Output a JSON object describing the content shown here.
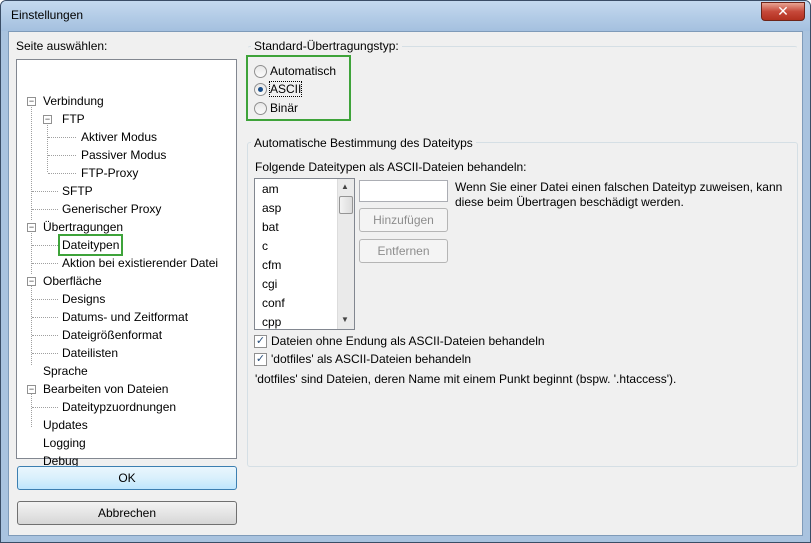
{
  "window": {
    "title": "Einstellungen",
    "close_glyph": "✕"
  },
  "tree": {
    "heading": "Seite auswählen:",
    "items": [
      {
        "label": "Verbindung"
      },
      {
        "label": "FTP"
      },
      {
        "label": "Aktiver Modus"
      },
      {
        "label": "Passiver Modus"
      },
      {
        "label": "FTP-Proxy"
      },
      {
        "label": "SFTP"
      },
      {
        "label": "Generischer Proxy"
      },
      {
        "label": "Übertragungen"
      },
      {
        "label": "Dateitypen",
        "selected": true
      },
      {
        "label": "Aktion bei existierender Datei"
      },
      {
        "label": "Oberfläche"
      },
      {
        "label": "Designs"
      },
      {
        "label": "Datums- und Zeitformat"
      },
      {
        "label": "Dateigrößenformat"
      },
      {
        "label": "Dateilisten"
      },
      {
        "label": "Sprache"
      },
      {
        "label": "Bearbeiten von Dateien"
      },
      {
        "label": "Dateitypzuordnungen"
      },
      {
        "label": "Updates"
      },
      {
        "label": "Logging"
      },
      {
        "label": "Debug"
      }
    ],
    "expander_glyph": "−"
  },
  "buttons": {
    "ok": "OK",
    "cancel": "Abbrechen"
  },
  "transfer_type": {
    "heading": "Standard-Übertragungstyp:",
    "options": [
      {
        "label": "Automatisch",
        "checked": false
      },
      {
        "label": "ASCII",
        "checked": true
      },
      {
        "label": "Binär",
        "checked": false
      }
    ]
  },
  "auto_detect": {
    "heading": "Automatische Bestimmung des Dateityps",
    "list_label": "Folgende Dateitypen als ASCII-Dateien behandeln:",
    "extensions": [
      "am",
      "asp",
      "bat",
      "c",
      "cfm",
      "cgi",
      "conf",
      "cpp"
    ],
    "extension_input": "",
    "hint": "Wenn Sie einer Datei einen falschen Dateityp zuweisen, kann diese beim Übertragen beschädigt werden.",
    "add_button": "Hinzufügen",
    "remove_button": "Entfernen",
    "checkbox_no_ext": "Dateien ohne Endung als ASCII-Dateien behandeln",
    "checkbox_dotfiles": "'dotfiles' als ASCII-Dateien behandeln",
    "dotfiles_note": "'dotfiles' sind Dateien, deren Name mit einem Punkt beginnt (bspw. '.htaccess').",
    "check_glyph": "✓",
    "scroll_up_glyph": "▲",
    "scroll_down_glyph": "▼"
  }
}
